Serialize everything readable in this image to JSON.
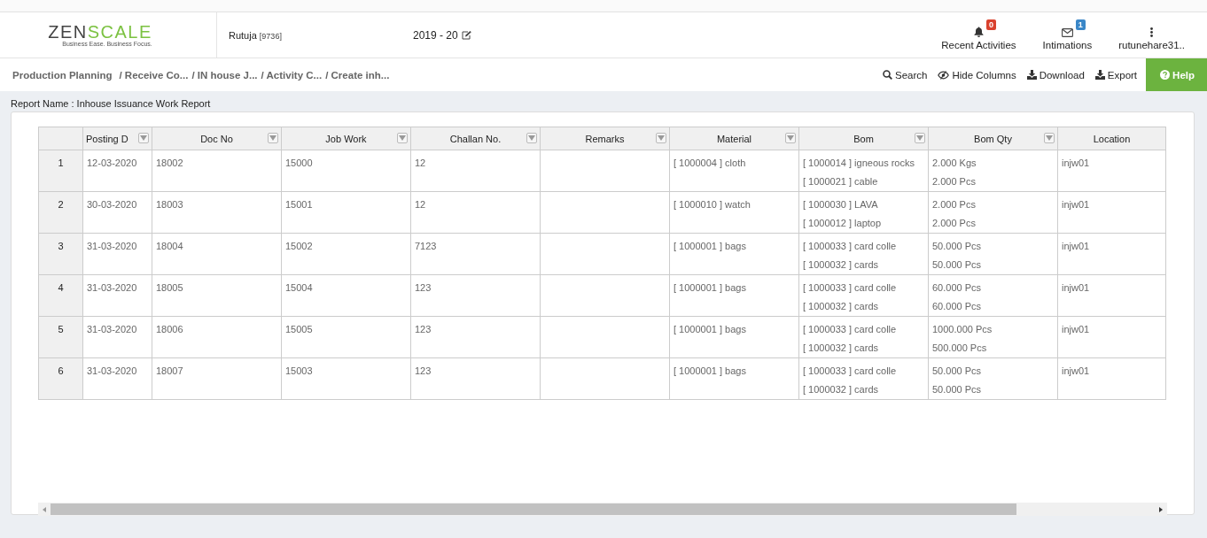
{
  "header": {
    "logo": {
      "brand_dark": "ZEN",
      "brand_green": "SCALE",
      "tagline": "Business Ease. Business Focus."
    },
    "user": {
      "name": "Rutuja",
      "code": "[9736]"
    },
    "year": "2019 - 20",
    "actions": [
      {
        "kind": "bell",
        "label": "Recent Activities",
        "badge": "0"
      },
      {
        "kind": "mail",
        "label": "Intimations",
        "badge": "1"
      },
      {
        "kind": "dots",
        "label": "rutunehare31.."
      }
    ]
  },
  "breadcrumb": [
    "Production Planning",
    "/ Receive Co...",
    "/ IN house J...",
    "/ Activity C...",
    "/ Create inh..."
  ],
  "toolbar": [
    {
      "kind": "search",
      "label": "Search"
    },
    {
      "kind": "eye",
      "label": "Hide Columns"
    },
    {
      "kind": "download",
      "label": "Download"
    },
    {
      "kind": "download",
      "label": "Export"
    },
    {
      "kind": "help",
      "label": "Help"
    }
  ],
  "report_name": "Report Name : Inhouse Issuance Work Report",
  "table": {
    "columns": [
      {
        "label": "Posting D",
        "filter": true,
        "kind": "date"
      },
      {
        "label": "Doc No",
        "filter": true,
        "kind": "wide"
      },
      {
        "label": "Job Work",
        "filter": true,
        "kind": "wide"
      },
      {
        "label": "Challan No.",
        "filter": true,
        "kind": "wide"
      },
      {
        "label": "Remarks",
        "filter": true,
        "kind": "wide"
      },
      {
        "label": "Material",
        "filter": true,
        "kind": "wide"
      },
      {
        "label": "Bom",
        "filter": true,
        "kind": "wide"
      },
      {
        "label": "Bom Qty",
        "filter": true,
        "kind": "wide"
      },
      {
        "label": "Location",
        "filter": false,
        "kind": "last"
      }
    ],
    "rows": [
      {
        "index": "1",
        "cells": [
          [
            "12-03-2020"
          ],
          [
            "18002"
          ],
          [
            "15000"
          ],
          [
            "12"
          ],
          [],
          [
            "[ 1000004 ] cloth"
          ],
          [
            "[ 1000014 ] igneous rocks",
            "[ 1000021 ] cable"
          ],
          [
            "2.000 Kgs",
            "2.000 Pcs"
          ],
          [
            "injw01"
          ]
        ]
      },
      {
        "index": "2",
        "cells": [
          [
            "30-03-2020"
          ],
          [
            "18003"
          ],
          [
            "15001"
          ],
          [
            "12"
          ],
          [],
          [
            "[ 1000010 ] watch"
          ],
          [
            "[ 1000030 ] LAVA",
            "[ 1000012 ] laptop"
          ],
          [
            "2.000 Pcs",
            "2.000 Pcs"
          ],
          [
            "injw01"
          ]
        ]
      },
      {
        "index": "3",
        "cells": [
          [
            "31-03-2020"
          ],
          [
            "18004"
          ],
          [
            "15002"
          ],
          [
            "7123"
          ],
          [],
          [
            "[ 1000001 ] bags"
          ],
          [
            "[ 1000033 ] card colle",
            "[ 1000032 ] cards"
          ],
          [
            "50.000 Pcs",
            "50.000 Pcs"
          ],
          [
            "injw01"
          ]
        ]
      },
      {
        "index": "4",
        "cells": [
          [
            "31-03-2020"
          ],
          [
            "18005"
          ],
          [
            "15004"
          ],
          [
            "123"
          ],
          [],
          [
            "[ 1000001 ] bags"
          ],
          [
            "[ 1000033 ] card colle",
            "[ 1000032 ] cards"
          ],
          [
            "60.000 Pcs",
            "60.000 Pcs"
          ],
          [
            "injw01"
          ]
        ]
      },
      {
        "index": "5",
        "cells": [
          [
            "31-03-2020"
          ],
          [
            "18006"
          ],
          [
            "15005"
          ],
          [
            "123"
          ],
          [],
          [
            "[ 1000001 ] bags"
          ],
          [
            "[ 1000033 ] card colle",
            "[ 1000032 ] cards"
          ],
          [
            "1000.000 Pcs",
            "500.000 Pcs"
          ],
          [
            "injw01"
          ]
        ]
      },
      {
        "index": "6",
        "cells": [
          [
            "31-03-2020"
          ],
          [
            "18007"
          ],
          [
            "15003"
          ],
          [
            "123"
          ],
          [],
          [
            "[ 1000001 ] bags"
          ],
          [
            "[ 1000033 ] card colle",
            "[ 1000032 ] cards"
          ],
          [
            "50.000 Pcs",
            "50.000 Pcs"
          ],
          [
            "injw01"
          ]
        ]
      }
    ]
  }
}
